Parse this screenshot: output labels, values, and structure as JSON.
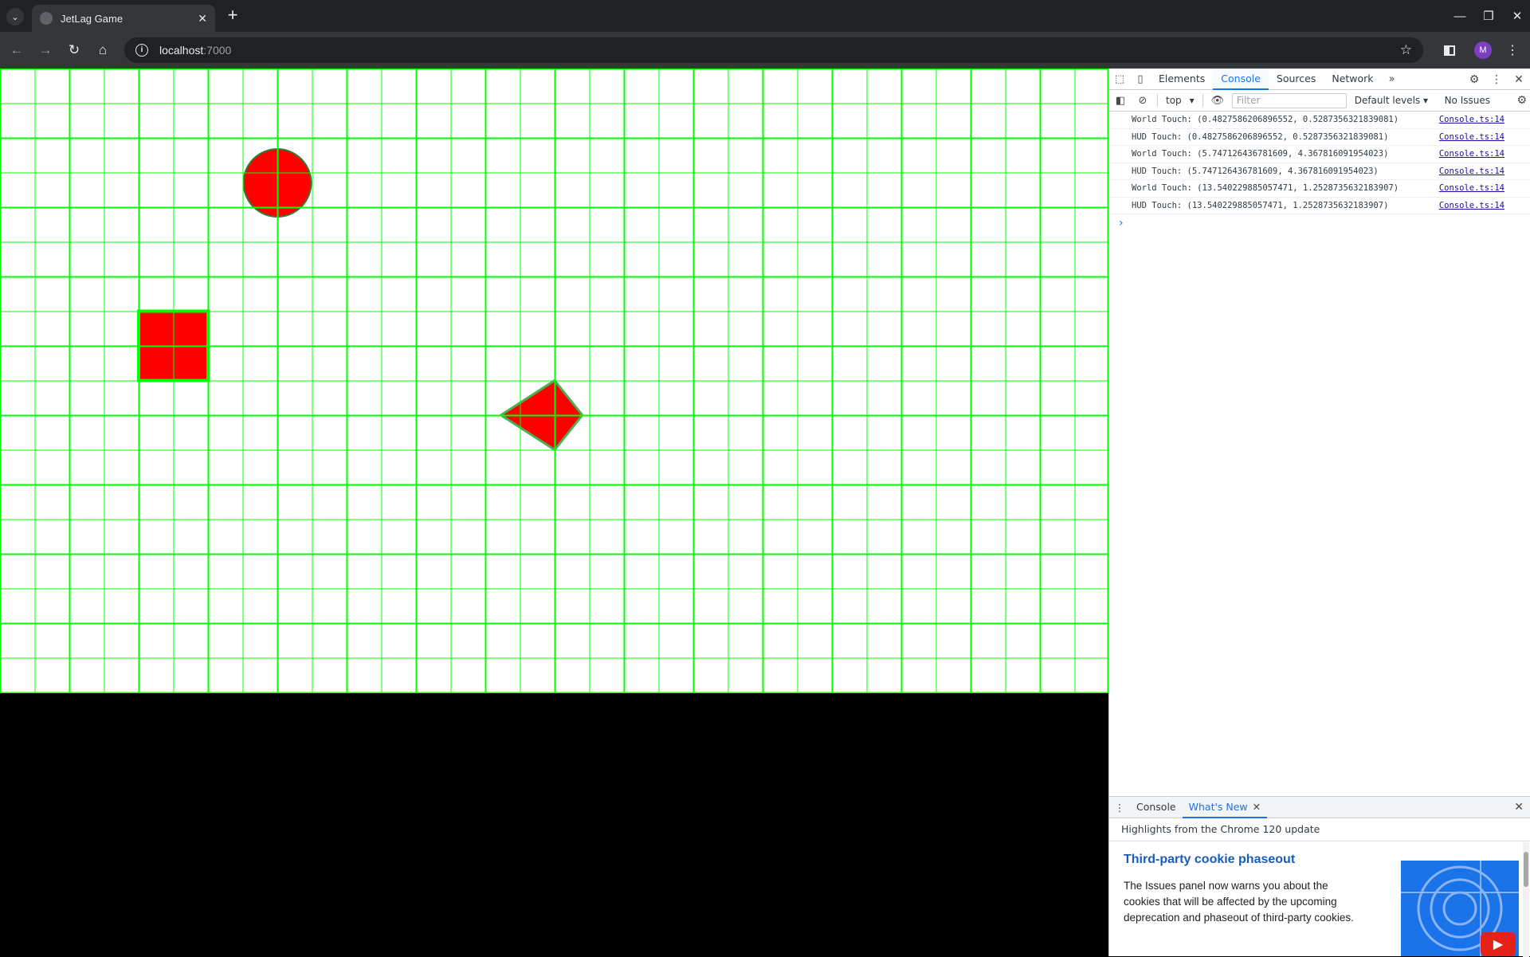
{
  "browser": {
    "tab_title": "JetLag Game",
    "url_host": "localhost",
    "url_port": ":7000",
    "profile_initial": "M"
  },
  "devtools": {
    "tabs": [
      "Elements",
      "Console",
      "Sources",
      "Network"
    ],
    "active_tab": "Console",
    "context": "top",
    "filter_placeholder": "Filter",
    "levels": "Default levels",
    "issues": "No Issues",
    "console_lines": [
      {
        "msg": "World Touch: (0.4827586206896552, 0.5287356321839081)",
        "src": "Console.ts:14"
      },
      {
        "msg": "HUD Touch: (0.4827586206896552, 0.5287356321839081)",
        "src": "Console.ts:14"
      },
      {
        "msg": "World Touch: (5.747126436781609, 4.367816091954023)",
        "src": "Console.ts:14"
      },
      {
        "msg": "HUD Touch: (5.747126436781609, 4.367816091954023)",
        "src": "Console.ts:14"
      },
      {
        "msg": "World Touch: (13.540229885057471, 1.2528735632183907)",
        "src": "Console.ts:14"
      },
      {
        "msg": "HUD Touch: (13.540229885057471, 1.2528735632183907)",
        "src": "Console.ts:14"
      }
    ],
    "drawer": {
      "tab_console": "Console",
      "tab_whats_new": "What's New",
      "header": "Highlights from the Chrome 120 update",
      "title": "Third-party cookie phaseout",
      "text": "The Issues panel now warns you about the cookies that will be affected by the upcoming deprecation and phaseout of third-party cookies."
    }
  },
  "game": {
    "grid_color": "#00ff00",
    "shape_fill": "#ff0000",
    "cols": 32,
    "rows": 18,
    "shapes": [
      {
        "kind": "circle",
        "name": "circle-actor"
      },
      {
        "kind": "square",
        "name": "square-actor"
      },
      {
        "kind": "polygon",
        "name": "polygon-actor"
      }
    ]
  }
}
